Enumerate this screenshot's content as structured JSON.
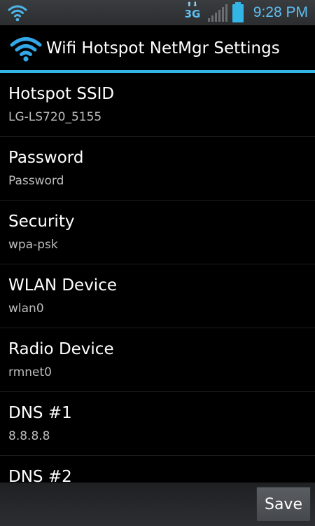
{
  "status_bar": {
    "network_type": "3G",
    "time": "9:28 PM",
    "icons": [
      "wifi-icon",
      "data-activity-icon",
      "signal-strength-icon",
      "battery-icon"
    ],
    "accent_color": "#5ec0f0"
  },
  "header": {
    "title": "Wifi Hotspot NetMgr Settings",
    "icon": "wifi-icon",
    "underline_color": "#33b5e5"
  },
  "settings": [
    {
      "title": "Hotspot SSID",
      "summary": "LG-LS720_5155"
    },
    {
      "title": "Password",
      "summary": "Password"
    },
    {
      "title": "Security",
      "summary": "wpa-psk"
    },
    {
      "title": "WLAN Device",
      "summary": "wlan0"
    },
    {
      "title": "Radio Device",
      "summary": "rmnet0"
    },
    {
      "title": "DNS #1",
      "summary": "8.8.8.8"
    },
    {
      "title": "DNS #2",
      "summary": ""
    }
  ],
  "footer": {
    "save_label": "Save"
  }
}
